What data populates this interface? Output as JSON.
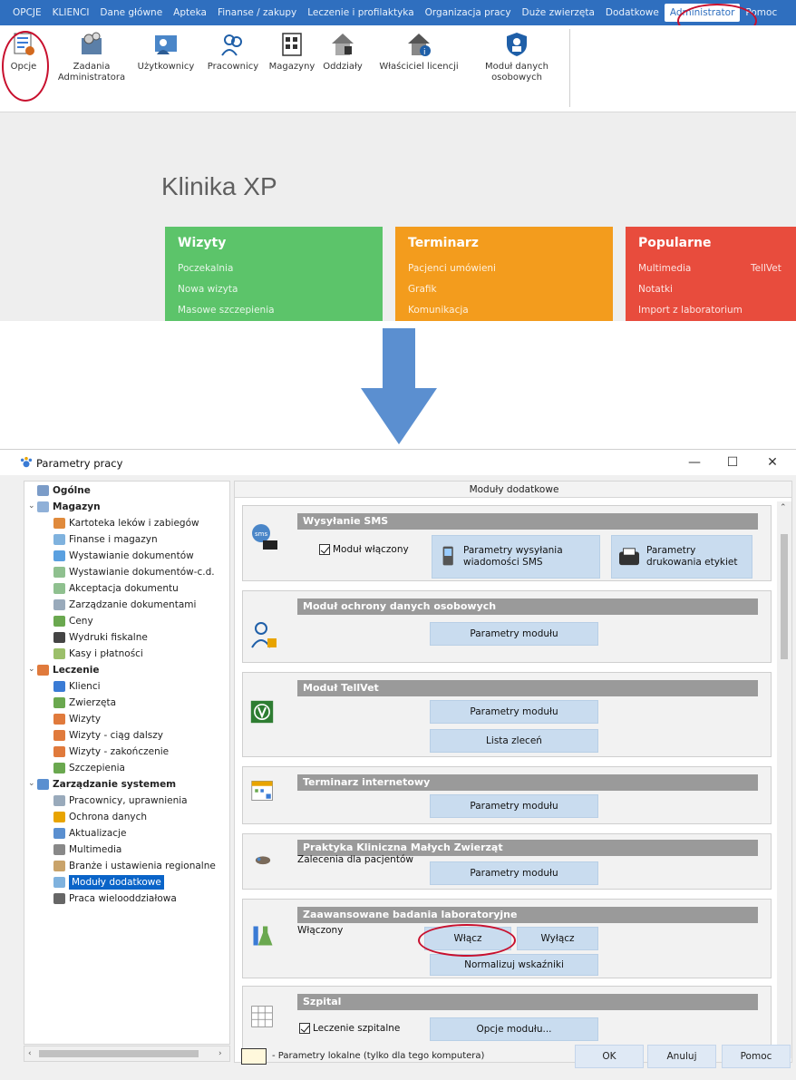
{
  "menubar": {
    "items": [
      "OPCJE",
      "KLIENCI",
      "Dane główne",
      "Apteka",
      "Finanse / zakupy",
      "Leczenie i profilaktyka",
      "Organizacja pracy",
      "Duże zwierzęta",
      "Dodatkowe",
      "Administrator",
      "Pomoc"
    ],
    "active": "Administrator"
  },
  "ribbon": {
    "items": [
      {
        "label": "Opcje",
        "icon": "checklist-gear-icon"
      },
      {
        "label": "Zadania Administratora",
        "icon": "admin-tasks-icon"
      },
      {
        "label": "Użytkownicy",
        "icon": "users-icon"
      },
      {
        "label": "Pracownicy",
        "icon": "employees-icon"
      },
      {
        "label": "Magazyny",
        "icon": "warehouse-icon"
      },
      {
        "label": "Oddziały",
        "icon": "branches-icon"
      },
      {
        "label": "Właściciel licencji",
        "icon": "license-owner-icon"
      },
      {
        "label": "Moduł danych osobowych",
        "icon": "shield-personal-data-icon"
      }
    ]
  },
  "home": {
    "title": "Klinika XP",
    "tiles": [
      {
        "title": "Wizyty",
        "color": "#5cc46a",
        "links": [
          "Poczekalnia",
          "Nowa wizyta",
          "Masowe szczepienia"
        ]
      },
      {
        "title": "Terminarz",
        "color": "#f39c1d",
        "links": [
          "Pacjenci umówieni",
          "Grafik",
          "Komunikacja"
        ]
      },
      {
        "title": "Popularne",
        "color": "#e84c3d",
        "links": [
          "Multimedia",
          "Notatki",
          "Import z laboratorium"
        ],
        "extra": "TellVet"
      }
    ]
  },
  "dialog": {
    "title": "Parametry pracy",
    "controls": {
      "minimize": "—",
      "maximize": "☐",
      "close": "✕"
    },
    "tree": [
      {
        "label": "Ogólne",
        "level": 0,
        "bold": true
      },
      {
        "label": "Magazyn",
        "level": 0,
        "bold": true,
        "expanded": true
      },
      {
        "label": "Kartoteka leków i zabiegów",
        "level": 1
      },
      {
        "label": "Finanse i magazyn",
        "level": 1
      },
      {
        "label": "Wystawianie dokumentów",
        "level": 1
      },
      {
        "label": "Wystawianie dokumentów-c.d.",
        "level": 1
      },
      {
        "label": "Akceptacja dokumentu",
        "level": 1
      },
      {
        "label": "Zarządzanie dokumentami",
        "level": 1
      },
      {
        "label": "Ceny",
        "level": 1
      },
      {
        "label": "Wydruki fiskalne",
        "level": 1
      },
      {
        "label": "Kasy i płatności",
        "level": 1
      },
      {
        "label": "Leczenie",
        "level": 0,
        "bold": true,
        "expanded": true
      },
      {
        "label": "Klienci",
        "level": 1
      },
      {
        "label": "Zwierzęta",
        "level": 1
      },
      {
        "label": "Wizyty",
        "level": 1
      },
      {
        "label": "Wizyty - ciąg dalszy",
        "level": 1
      },
      {
        "label": "Wizyty - zakończenie",
        "level": 1
      },
      {
        "label": "Szczepienia",
        "level": 1
      },
      {
        "label": "Zarządzanie systemem",
        "level": 0,
        "bold": true,
        "expanded": true
      },
      {
        "label": "Pracownicy, uprawnienia",
        "level": 1
      },
      {
        "label": "Ochrona danych",
        "level": 1
      },
      {
        "label": "Aktualizacje",
        "level": 1
      },
      {
        "label": "Multimedia",
        "level": 1
      },
      {
        "label": "Branże i ustawienia regionalne",
        "level": 1
      },
      {
        "label": "Moduły dodatkowe",
        "level": 1,
        "selected": true
      },
      {
        "label": "Praca wielooddziałowa",
        "level": 1
      }
    ],
    "content_header": "Moduły dodatkowe",
    "panels": {
      "sms": {
        "title": "Wysyłanie SMS",
        "checkbox": "Moduł włączony",
        "btn1": "Parametry wysyłania wiadomości SMS",
        "btn2": "Parametry drukowania etykiet"
      },
      "privacy": {
        "title": "Moduł ochrony danych osobowych",
        "btn": "Parametry modułu"
      },
      "tellvet": {
        "title": "Moduł TellVet",
        "btn1": "Parametry modułu",
        "btn2": "Lista zleceń"
      },
      "calendar": {
        "title": "Terminarz internetowy",
        "btn": "Parametry modułu"
      },
      "practice": {
        "title": "Praktyka Kliniczna Małych Zwierząt",
        "text": "Zalecenia dla pacjentów",
        "btn": "Parametry modułu"
      },
      "lab": {
        "title": "Zaawansowane badania laboratoryjne",
        "status": "Włączony",
        "btn_on": "Włącz",
        "btn_off": "Wyłącz",
        "btn_norm": "Normalizuj wskaźniki"
      },
      "hospital": {
        "title": "Szpital",
        "checkbox": "Leczenie szpitalne",
        "btn": "Opcje modułu..."
      }
    },
    "footer": {
      "legend": "- Parametry lokalne (tylko dla tego komputera)",
      "ok": "OK",
      "cancel": "Anuluj",
      "help": "Pomoc"
    }
  },
  "colors": {
    "menubar": "#2f6fbf",
    "highlight_ring": "#c8102e",
    "selected": "#0a64c8",
    "button": "#c9dcef",
    "panel_header": "#9a9a9a"
  }
}
